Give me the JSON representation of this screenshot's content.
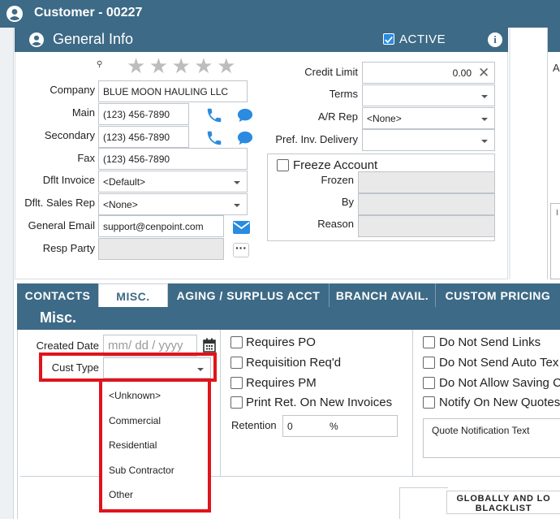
{
  "window": {
    "title": "Customer - 00227"
  },
  "general_info": {
    "title": "General Info",
    "active_label": "ACTIVE",
    "active_checked": true,
    "rating_stars": 5,
    "labels": {
      "company": "Company",
      "main": "Main",
      "secondary": "Secondary",
      "fax": "Fax",
      "dflt_invoice": "Dflt Invoice",
      "dflt_sales_rep": "Dflt. Sales Rep",
      "general_email": "General Email",
      "resp_party": "Resp Party"
    },
    "values": {
      "company": "BLUE MOON HAULING LLC",
      "main": "(123) 456-7890",
      "secondary": "(123) 456-7890",
      "fax": "(123) 456-7890",
      "dflt_invoice": "<Default>",
      "dflt_sales_rep": "<None>",
      "general_email": "support@cenpoint.com",
      "resp_party": ""
    },
    "right": {
      "credit_limit_label": "Credit Limit",
      "credit_limit_value": "0.00",
      "terms_label": "Terms",
      "terms_value": "",
      "ar_rep_label": "A/R Rep",
      "ar_rep_value": "<None>",
      "pref_inv_label": "Pref. Inv. Delivery",
      "pref_inv_value": ""
    },
    "freeze": {
      "label": "Freeze Account",
      "frozen_label": "Frozen",
      "by_label": "By",
      "reason_label": "Reason"
    }
  },
  "right_panel": {
    "letter": "A",
    "box_letter": "I"
  },
  "tabs": [
    {
      "label": "CONTACTS"
    },
    {
      "label": "MISC."
    },
    {
      "label": "AGING / SURPLUS ACCT"
    },
    {
      "label": "BRANCH AVAIL."
    },
    {
      "label": "CUSTOM PRICING"
    }
  ],
  "misc": {
    "title": "Misc.",
    "created_date_label": "Created Date",
    "created_date_placeholder": "mm/ dd / yyyy",
    "cust_type_label": "Cust Type",
    "cust_type_options": [
      "<Unknown>",
      "Commercial",
      "Residential",
      "Sub Contractor",
      "Other"
    ],
    "checks_mid": [
      "Requires PO",
      "Requisition Req'd",
      "Requires PM",
      "Print Ret. On New Invoices"
    ],
    "retention_label": "Retention",
    "retention_value": "0",
    "retention_unit": "%",
    "checks_right": [
      "Do Not Send Links",
      "Do Not Send Auto Tex",
      "Do Not Allow Saving C",
      "Notify On New Quotes"
    ],
    "quote_notification_label": "Quote Notification Text",
    "blacklist_button": "GLOBALLY AND LO BLACKLIST"
  },
  "colors": {
    "header": "#3d6a86",
    "highlight": "#e0141b",
    "icon_blue": "#2a8be0"
  }
}
